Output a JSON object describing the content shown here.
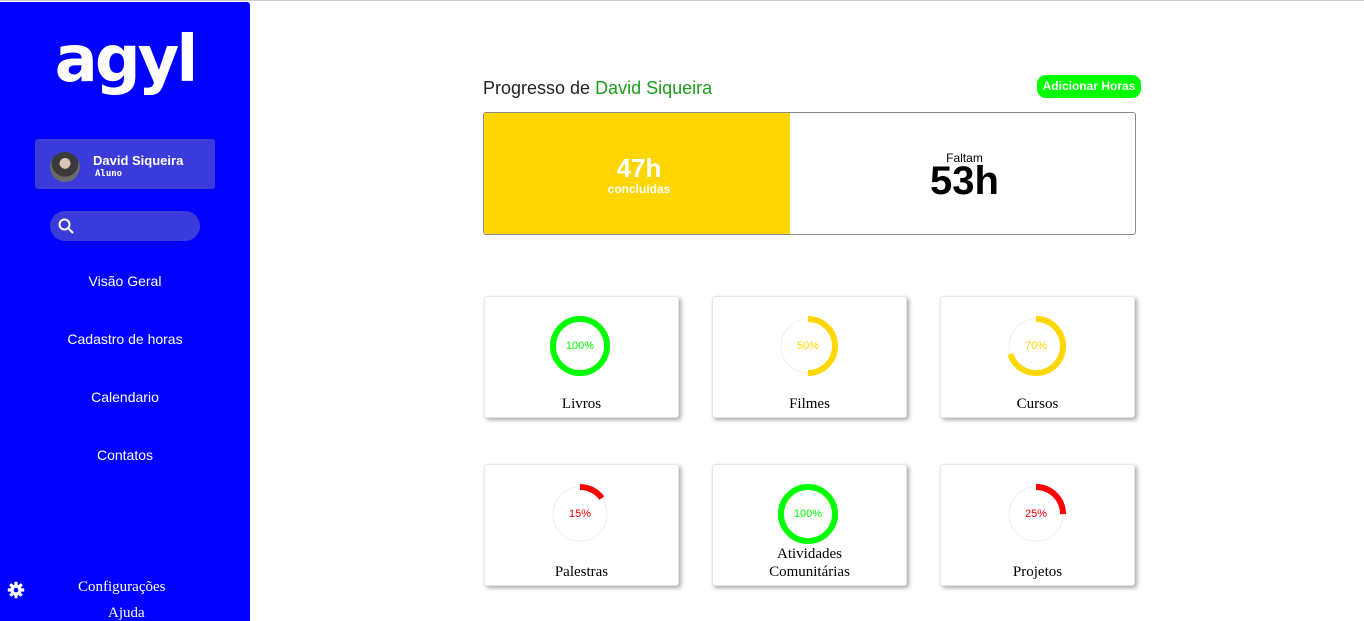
{
  "sidebar": {
    "logo": "agyl",
    "user": {
      "name": "David Siqueira",
      "role": "Aluno"
    },
    "search": {
      "placeholder": ""
    },
    "nav": [
      "Visão Geral",
      "Cadastro de horas",
      "Calendario",
      "Contatos"
    ],
    "settings_label": "Configurações",
    "help_label": "Ajuda"
  },
  "header": {
    "title_prefix": "Progresso de ",
    "user_name": "David Siqueira",
    "add_button": "Adicionar Horas"
  },
  "progress": {
    "completed": "47h",
    "completed_label": "concluídas",
    "remaining_label": "Faltam",
    "remaining": "53h",
    "fraction_completed": 0.47
  },
  "categories": [
    {
      "label": "Livros",
      "percent": 100,
      "percent_text": "100%",
      "color": "#00ff00"
    },
    {
      "label": "Filmes",
      "percent": 50,
      "percent_text": "50%",
      "color": "#ffd700"
    },
    {
      "label": "Cursos",
      "percent": 70,
      "percent_text": "70%",
      "color": "#ffd700"
    },
    {
      "label": "Palestras",
      "percent": 15,
      "percent_text": "15%",
      "color": "#ff0000"
    },
    {
      "label": "Atividades Comunitárias",
      "percent": 100,
      "percent_text": "100%",
      "color": "#00ff00"
    },
    {
      "label": "Projetos",
      "percent": 25,
      "percent_text": "25%",
      "color": "#ff0000"
    }
  ],
  "colors": {
    "sidebar": "#0000ff",
    "accent": "#00ff00",
    "progress": "#ffd700",
    "user_name": "#1c9e1c"
  },
  "icons": [
    "search-icon",
    "gear-icon"
  ]
}
